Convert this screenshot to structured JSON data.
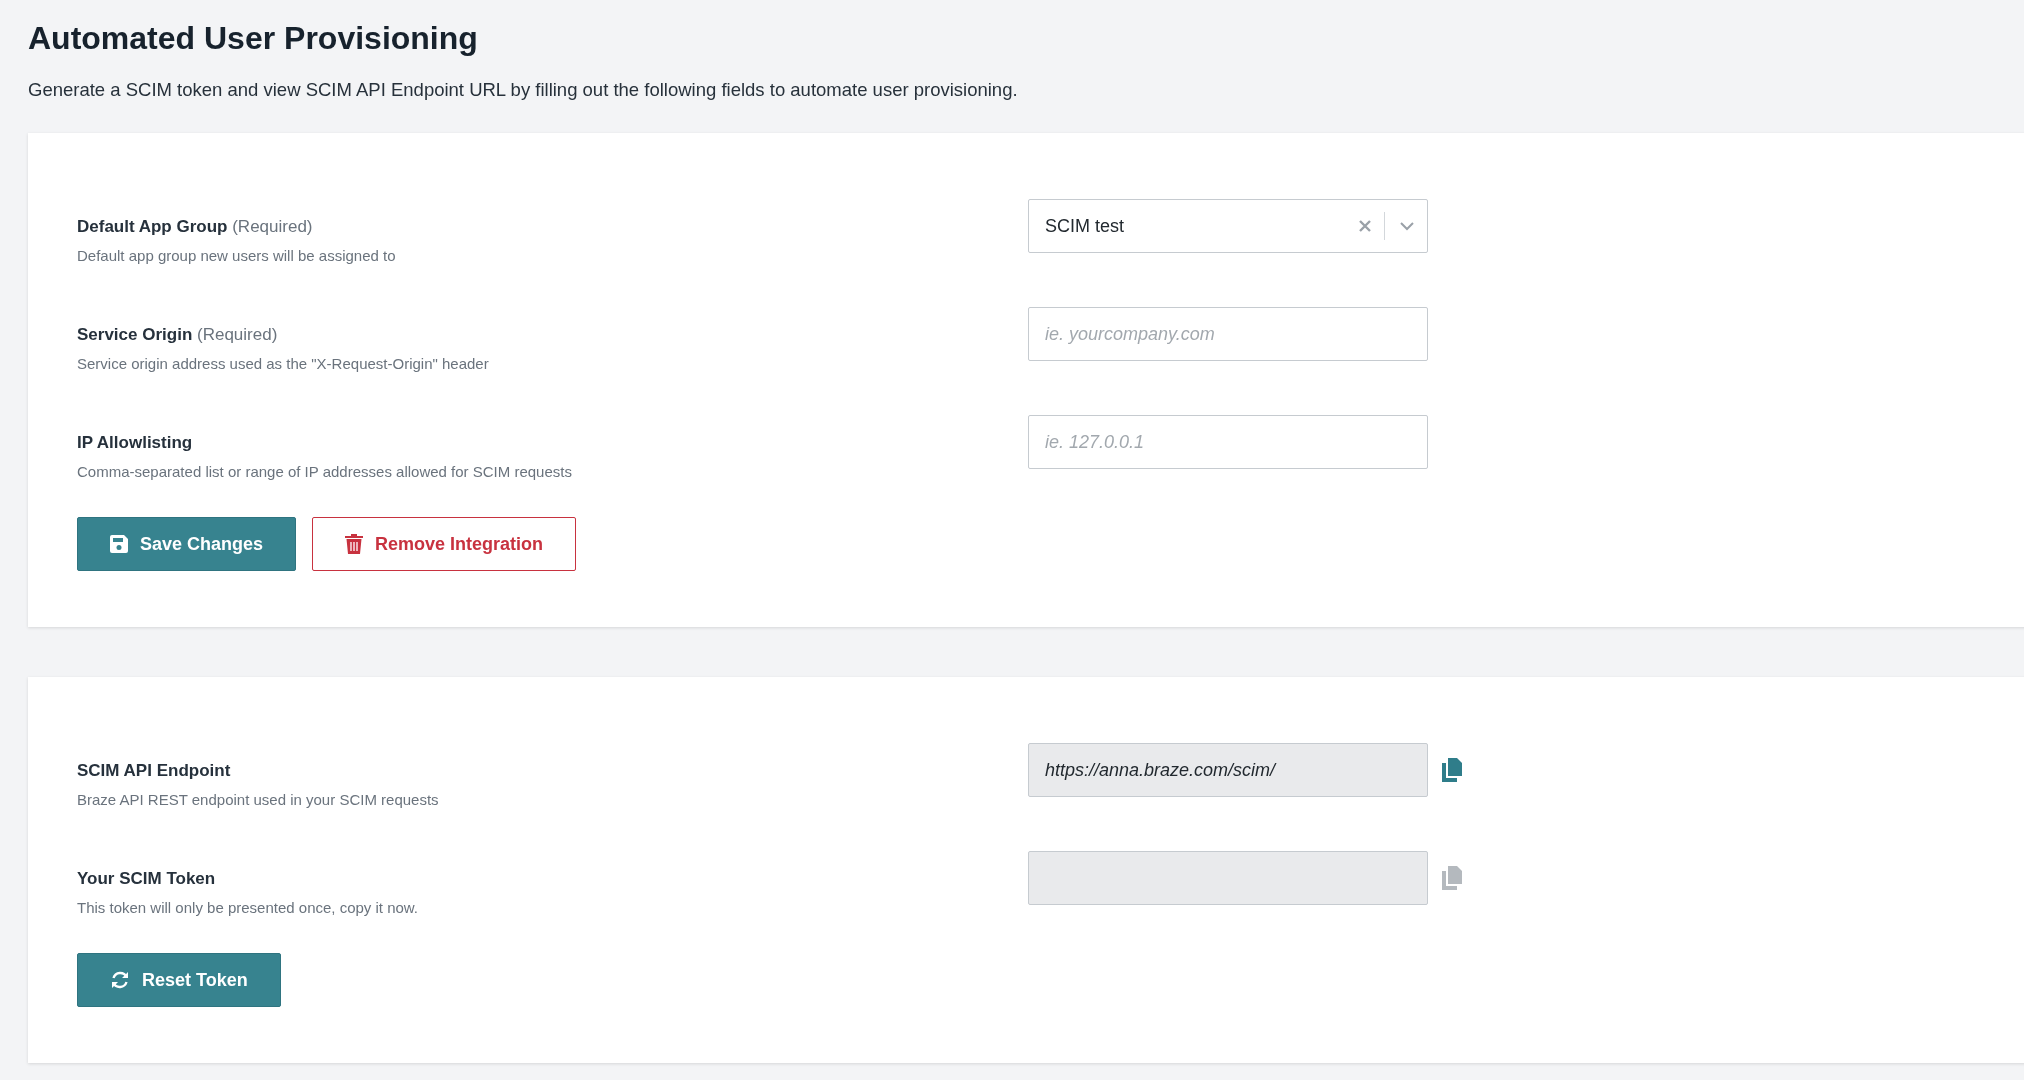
{
  "header": {
    "title": "Automated User Provisioning",
    "description": "Generate a SCIM token and view SCIM API Endpoint URL by filling out the following fields to automate user provisioning."
  },
  "settings_card": {
    "fields": [
      {
        "kind": "select",
        "label": "**Default App Group** (Required)",
        "help": "Default app group new users will be assigned to",
        "value": "SCIM test"
      },
      {
        "kind": "input",
        "label": "**Service Origin** (Required)",
        "help": "Service origin address used as the \"X-Request-Origin\" header",
        "placeholder": "ie. yourcompany.com"
      },
      {
        "kind": "input",
        "label": "**IP Allowlisting**",
        "help": "Comma-separated list or range of IP addresses allowed for SCIM requests",
        "placeholder": "ie. 127.0.0.1"
      }
    ],
    "buttons": [
      {
        "kind": "save",
        "label": "Save Changes"
      },
      {
        "kind": "remove",
        "label": "Remove Integration"
      }
    ]
  },
  "token_card": {
    "fields": [
      {
        "kind": "readonly",
        "label": "**SCIM API Endpoint**",
        "help": "Braze API REST endpoint used in your SCIM requests",
        "value": "https://anna.braze.com/scim/",
        "copy_disabled": false
      },
      {
        "kind": "readonly",
        "label": "**Your SCIM Token**",
        "help": "This token will only be presented once, copy it now.",
        "copy_disabled": true
      }
    ],
    "buttons": [
      {
        "kind": "reset",
        "label": "Reset Token"
      }
    ]
  }
}
